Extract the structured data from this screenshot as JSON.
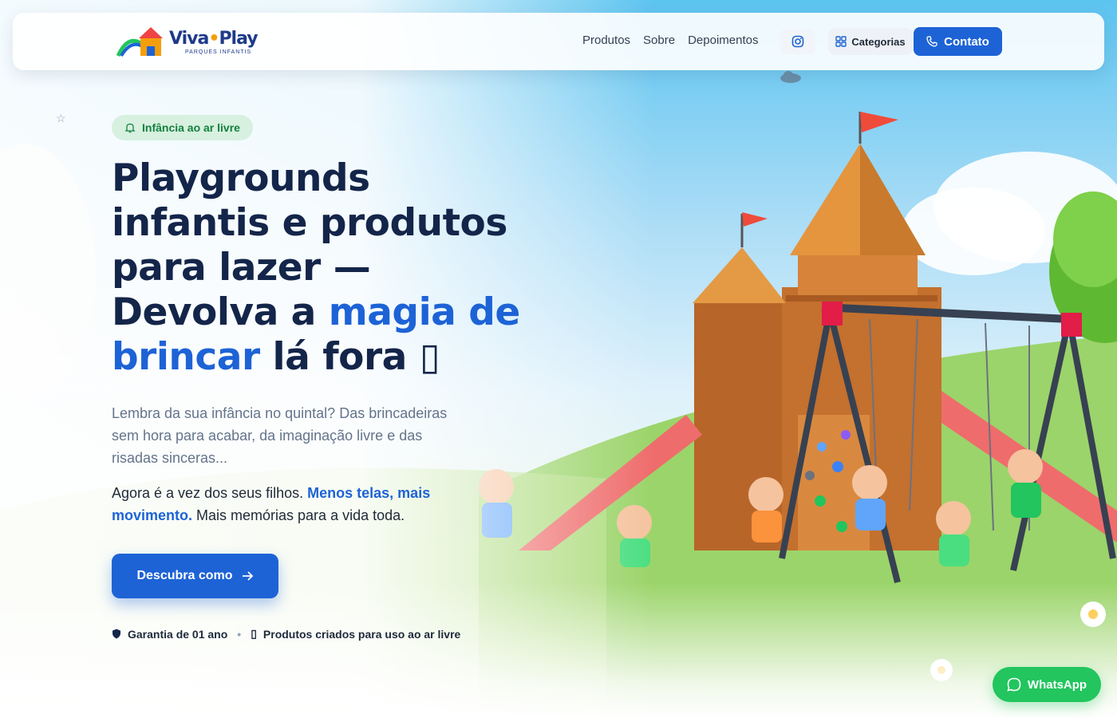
{
  "brand": {
    "name_part1": "Viva",
    "name_part2": "Play",
    "subtitle": "PARQUES INFANTIS"
  },
  "nav": {
    "links": [
      "Produtos",
      "Sobre",
      "Depoimentos"
    ],
    "categories_label": "Categorias",
    "contact_label": "Contato"
  },
  "hero": {
    "badge": "Infância ao ar livre",
    "title_part1": "Playgrounds infantis e produtos para lazer — Devolva a ",
    "title_accent": "magia de brincar",
    "title_part2": " lá fora",
    "title_glyph": "▯",
    "lead": "Lembra da sua infância no quintal? Das brincadeiras sem hora para acabar, da imaginação livre e das risadas sinceras...",
    "lead2_part1": "Agora é a vez dos seus filhos. ",
    "lead2_highlight": "Menos telas, mais movimento.",
    "lead2_part2": " Mais memórias para a vida toda.",
    "cta_label": "Descubra como",
    "trust_1": "Garantia de 01 ano",
    "trust_2": "Produtos criados para uso ao ar livre"
  },
  "whatsapp_label": "WhatsApp",
  "colors": {
    "primary": "#1d63d6",
    "dark": "#14254a",
    "green": "#22c55e",
    "badge_bg": "#d7f0e0"
  }
}
